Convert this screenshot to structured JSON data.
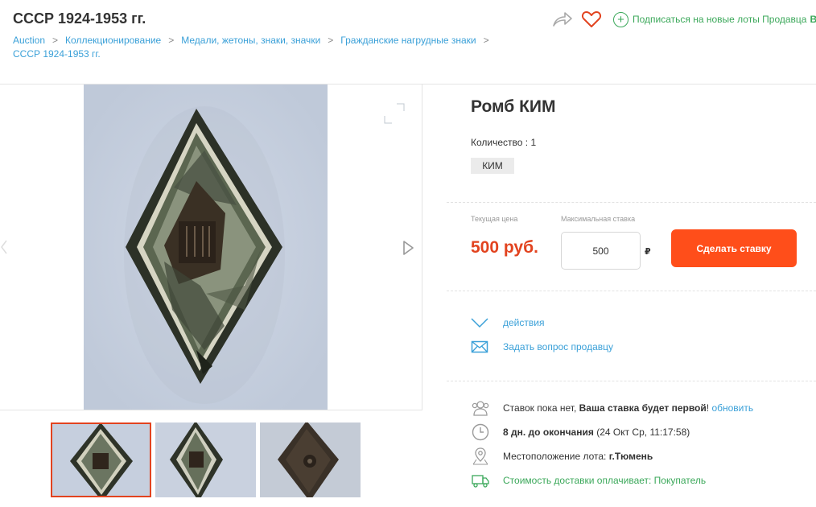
{
  "header": {
    "title": "СССР 1924-1953 гг.",
    "subscribe_label": "Подписаться на новые лоты Продавца",
    "subscribe_tail": "В"
  },
  "breadcrumb": [
    "Auction",
    "Коллекционирование",
    "Медали, жетоны, знаки, значки",
    "Гражданские нагрудные знаки",
    "СССР 1924-1953 гг."
  ],
  "lot": {
    "title": "Ромб КИМ",
    "quantity": "Количество : 1",
    "tag": "КИМ"
  },
  "bid": {
    "current_price_label": "Текущая цена",
    "max_bid_label": "Максимальная ставка",
    "price": "500 руб.",
    "input_value": "500",
    "currency": "₽",
    "button_label": "Сделать ставку"
  },
  "links": {
    "actions": "действия",
    "ask_seller": "Задать вопрос продавцу"
  },
  "info": {
    "bids_prefix": "Ставок пока нет,",
    "bids_bold": "Ваша ставка будет первой",
    "bids_excl": "!",
    "refresh": "обновить",
    "time_bold": "8 дн. до окончания",
    "time_detail": "(24 Окт Ср, 11:17:58)",
    "location_label": "Местоположение лота:",
    "location_value": "г.Тюмень",
    "delivery": "Стоимость доставки оплачивает: Покупатель"
  },
  "colors": {
    "accent": "#ff4e1a",
    "price": "#e2431f",
    "link": "#3aa0d8",
    "green": "#3ba85a"
  },
  "icons": [
    "share-icon",
    "heart-icon",
    "plus-circle-icon",
    "expand-icon",
    "chevron-left-icon",
    "chevron-right-icon",
    "chevron-down-icon",
    "envelope-icon",
    "users-icon",
    "clock-icon",
    "map-pin-icon",
    "truck-icon"
  ]
}
